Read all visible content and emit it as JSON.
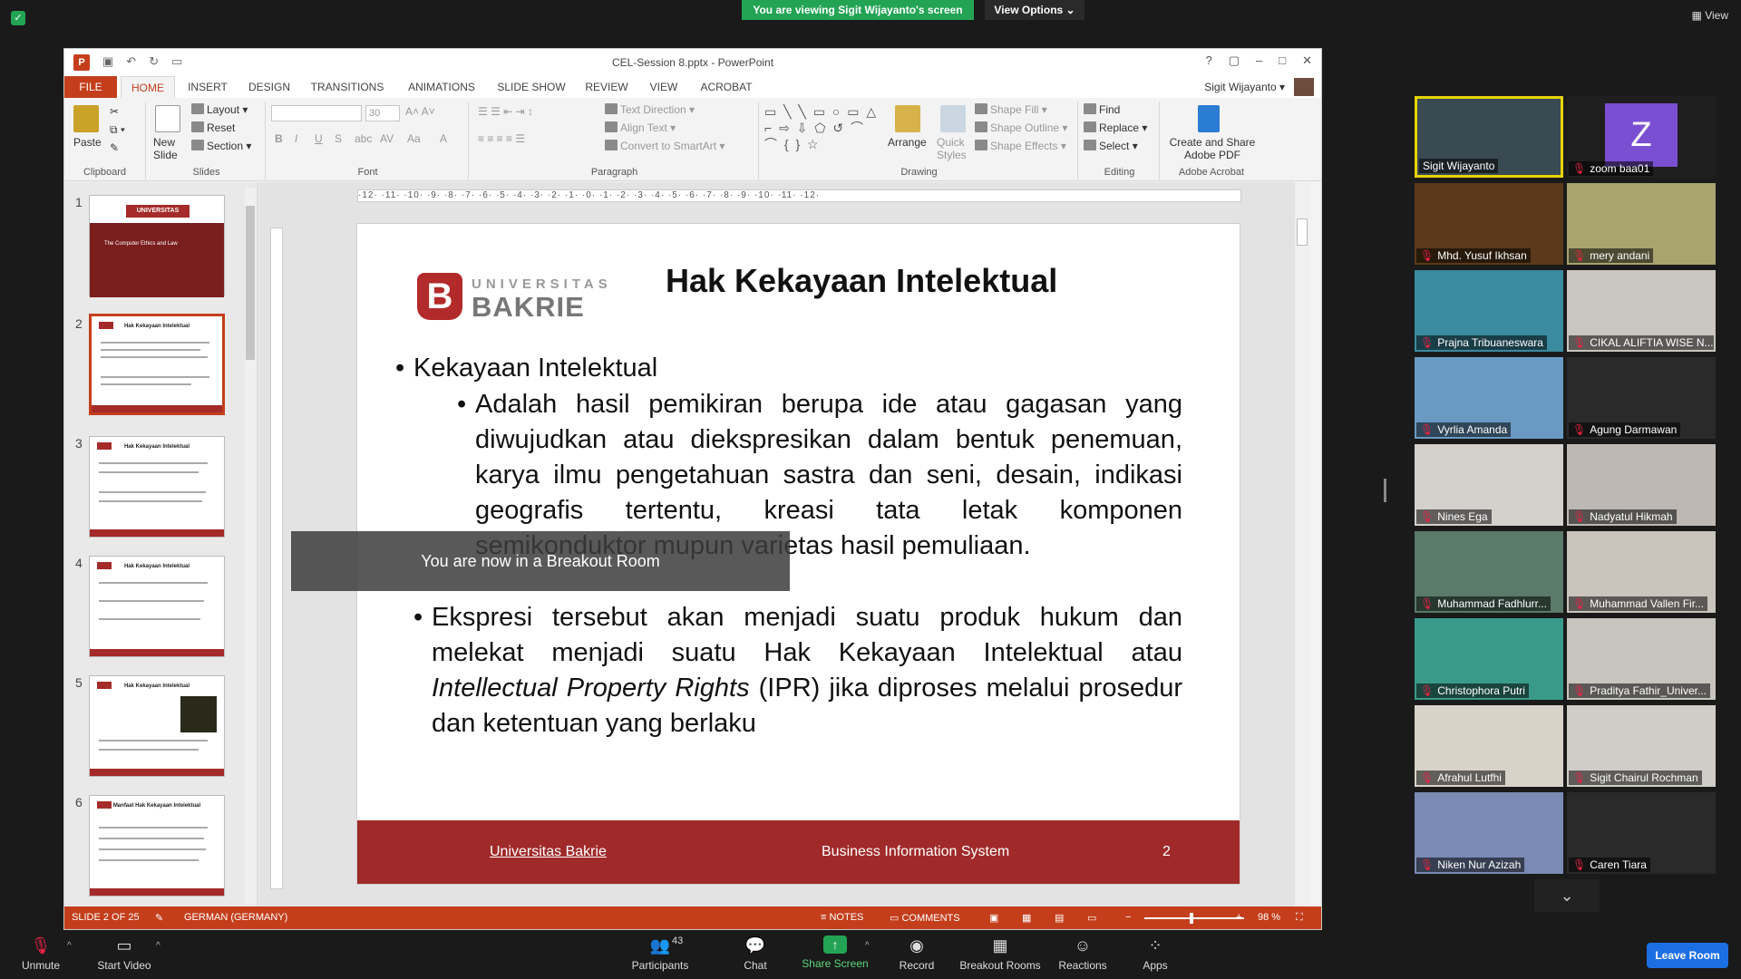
{
  "zoom": {
    "viewing_banner": "You are viewing Sigit Wijayanto's screen",
    "view_options": "View Options ⌄",
    "top_view": "View",
    "leave": "Leave Room",
    "breakout_notice": "You are now in a Breakout Room",
    "toolbar": {
      "unmute": "Unmute",
      "start_video": "Start Video",
      "participants": "Participants",
      "participant_count": "43",
      "chat": "Chat",
      "share_screen": "Share Screen",
      "record": "Record",
      "breakout_rooms": "Breakout Rooms",
      "reactions": "Reactions",
      "apps": "Apps"
    }
  },
  "ppt": {
    "title": "CEL-Session 8.pptx - PowerPoint",
    "user": "Sigit Wijayanto",
    "tabs": [
      "FILE",
      "HOME",
      "INSERT",
      "DESIGN",
      "TRANSITIONS",
      "ANIMATIONS",
      "SLIDE SHOW",
      "REVIEW",
      "VIEW",
      "ACROBAT"
    ],
    "ribbon": {
      "paste": "Paste",
      "new_slide": "New Slide",
      "layout": "Layout",
      "reset": "Reset",
      "section": "Section",
      "clipboard": "Clipboard",
      "slides": "Slides",
      "font_size": "30",
      "font": "Font",
      "paragraph": "Paragraph",
      "text_direction": "Text Direction",
      "align_text": "Align Text",
      "convert_smartart": "Convert to SmartArt",
      "arrange": "Arrange",
      "quick_styles": "Quick Styles",
      "shape_fill": "Shape Fill",
      "shape_outline": "Shape Outline",
      "shape_effects": "Shape Effects",
      "drawing": "Drawing",
      "find": "Find",
      "replace": "Replace",
      "select": "Select",
      "editing": "Editing",
      "create_share_pdf": "Create and Share Adobe PDF",
      "adobe_acrobat": "Adobe Acrobat"
    },
    "thumbnails": [
      {
        "num": "1",
        "title": "The Computer Ethics and Law"
      },
      {
        "num": "2",
        "title": "Hak Kekayaan Intelektual"
      },
      {
        "num": "3",
        "title": "Hak Kekayaan Intelektual"
      },
      {
        "num": "4",
        "title": "Hak Kekayaan Intelektual"
      },
      {
        "num": "5",
        "title": "Hak Kekayaan Intelektual"
      },
      {
        "num": "6",
        "title": "Manfaat Hak Kekayaan Intelektual"
      }
    ],
    "thumb1_logo": "UNIVERSITAS BAKRIE",
    "ruler_h": "·12·  ·11·  ·10·  ·9·  ·8·  ·7·  ·6·  ·5·  ·4·  ·3·  ·2·  ·1·  ·0·  ·1·  ·2·  ·3·  ·4·  ·5·  ·6·  ·7·  ·8·  ·9·  ·10·  ·11·  ·12·",
    "slide": {
      "logo_top": "UNIVERSITAS",
      "logo_bottom": "BAKRIE",
      "logo_letter": "B",
      "title": "Hak Kekayaan Intelektual",
      "bullet1": "Kekayaan Intelektual",
      "bullet1_sub": "Adalah hasil pemikiran berupa ide atau gagasan yang diwujudkan atau diekspresikan dalam bentuk penemuan, karya ilmu pengetahuan sastra dan seni, desain, indikasi geografis tertentu, kreasi tata letak komponen semikonduktor mupun varietas hasil pemuliaan.",
      "bullet2_a": "Ekspresi tersebut akan menjadi suatu produk hukum dan melekat menjadi suatu Hak Kekayaan Intelektual atau ",
      "bullet2_italic": "Intellectual Property Rights",
      "bullet2_b": " (IPR) jika diproses melalui prosedur dan ketentuan yang berlaku",
      "footer_left": "Universitas Bakrie",
      "footer_mid": "Business Information System",
      "footer_num": "2"
    },
    "status": {
      "slide": "SLIDE 2 OF 25",
      "language": "GERMAN (GERMANY)",
      "notes": "NOTES",
      "comments": "COMMENTS",
      "zoom": "98 %"
    }
  },
  "participants": [
    {
      "name": "Sigit Wijayanto",
      "muted": false,
      "bg": "#3a4a52"
    },
    {
      "name": "zoom baa01",
      "muted": true,
      "bg": "#1f1f1f"
    },
    {
      "name": "Mhd. Yusuf Ikhsan",
      "muted": true,
      "bg": "#5a3a1a"
    },
    {
      "name": "mery andani",
      "muted": true,
      "bg": "#a8a470"
    },
    {
      "name": "Prajna Tribuaneswara",
      "muted": true,
      "bg": "#3a8aa0"
    },
    {
      "name": "CIKAL ALIFTIA WISE N...",
      "muted": true,
      "bg": "#c9c6c0"
    },
    {
      "name": "Vyrlia Amanda",
      "muted": true,
      "bg": "#6a9ac4"
    },
    {
      "name": "Agung Darmawan",
      "muted": true,
      "bg": "#2a2a2a"
    },
    {
      "name": "Nines Ega",
      "muted": true,
      "bg": "#d4d0cc"
    },
    {
      "name": "Nadyatul Hikmah",
      "muted": true,
      "bg": "#bdb8b4"
    },
    {
      "name": "Muhammad Fadhlurr...",
      "muted": true,
      "bg": "#5a7a6a"
    },
    {
      "name": "Muhammad Vallen Fir...",
      "muted": true,
      "bg": "#c9c4bc"
    },
    {
      "name": "Christophora Putri",
      "muted": true,
      "bg": "#3a9a8a"
    },
    {
      "name": "Praditya Fathir_Univer...",
      "muted": true,
      "bg": "#c8c4be"
    },
    {
      "name": "Afrahul Lutfhi",
      "muted": true,
      "bg": "#d8d2c8"
    },
    {
      "name": "Sigit Chairul Rochman",
      "muted": true,
      "bg": "#d0ccc8"
    },
    {
      "name": "Niken Nur Azizah",
      "muted": true,
      "bg": "#7a8ab4"
    },
    {
      "name": "Caren Tiara",
      "muted": true,
      "bg": "#2a2a2a"
    }
  ],
  "zavatar_letter": "Z"
}
